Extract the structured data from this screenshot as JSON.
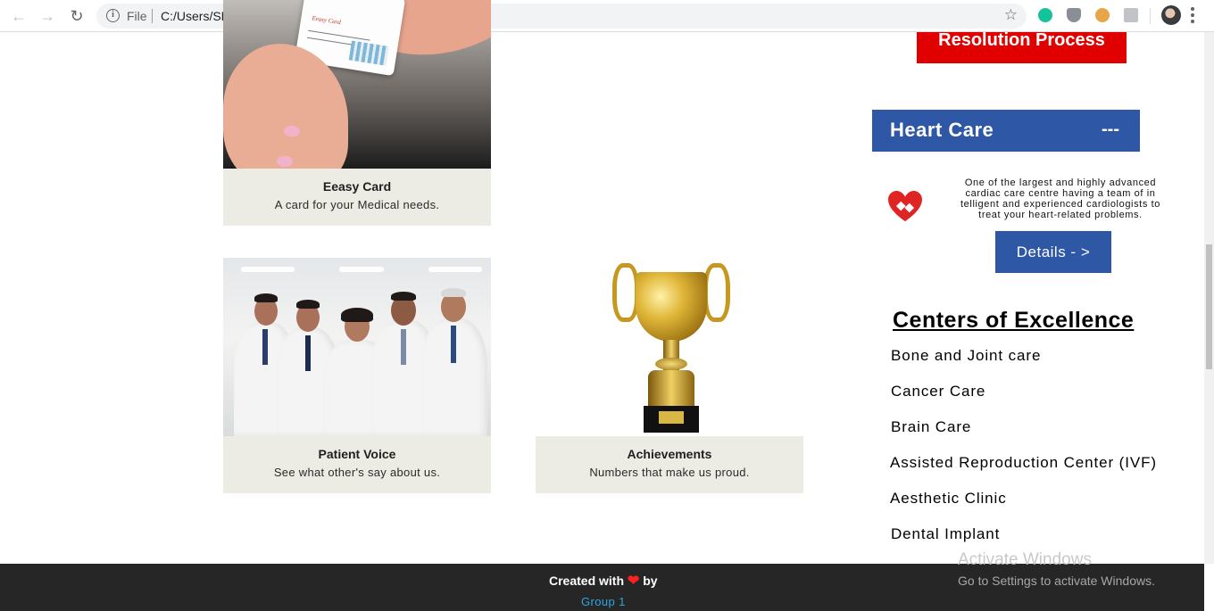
{
  "browser": {
    "scheme_label": "File",
    "url": "C:/Users/SHIVANI/Desktop/wt/Home.html"
  },
  "cards": [
    {
      "title": "Eeasy Card",
      "desc": "A card for your Medical needs.",
      "image_text": "Eeasy Card"
    },
    {
      "title": "Patient Voice",
      "desc": "See what other's say about us."
    },
    {
      "title": "Achievements",
      "desc": "Numbers that make us proud."
    }
  ],
  "sidebar": {
    "resolution_label": "Resolution Process",
    "heart_care": {
      "title": "Heart Care",
      "toggle": "---",
      "description": "One of the largest and highly advanced cardiac care centre having a team of in telligent and experienced cardiologists to treat your heart-related problems.",
      "details_label": "Details - >"
    },
    "centers_title": "Centers of Excellence",
    "centers": [
      "Bone and Joint care",
      "Cancer Care",
      "Brain Care",
      "Assisted Reproduction Center (IVF)",
      "Aesthetic Clinic",
      "Dental Implant"
    ]
  },
  "footer": {
    "created_with": "Created with",
    "by": "by",
    "group": "Group 1"
  },
  "watermark": {
    "line1": "Activate Windows",
    "line2": "Go to Settings to activate Windows."
  },
  "colors": {
    "heart_care_blue": "#2e58a6",
    "resolution_red": "#e00000",
    "footer_bg": "#262626",
    "caption_bg": "#ecebe4",
    "group_link": "#2ea7e0"
  }
}
